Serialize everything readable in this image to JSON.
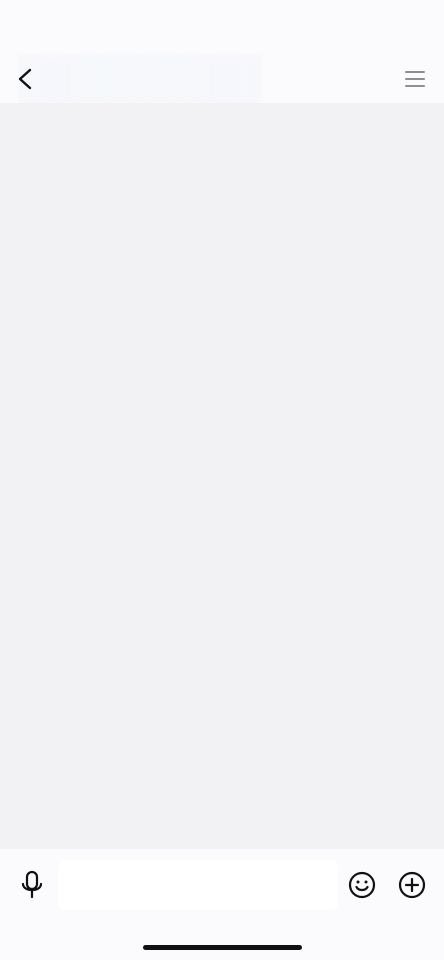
{
  "app": {
    "screen": "chat"
  },
  "header": {
    "back_icon": "chevron-left-icon",
    "menu_icon": "hamburger-menu-icon",
    "title": ""
  },
  "composer": {
    "mic_icon": "microphone-icon",
    "input_value": "",
    "input_placeholder": "",
    "emoji_icon": "smiley-face-icon",
    "add_icon": "plus-circle-icon"
  },
  "colors": {
    "background": "#f2f1f4",
    "bars": "#fbfafc",
    "icon": "#111111",
    "menu_icon": "#8e8e93"
  }
}
